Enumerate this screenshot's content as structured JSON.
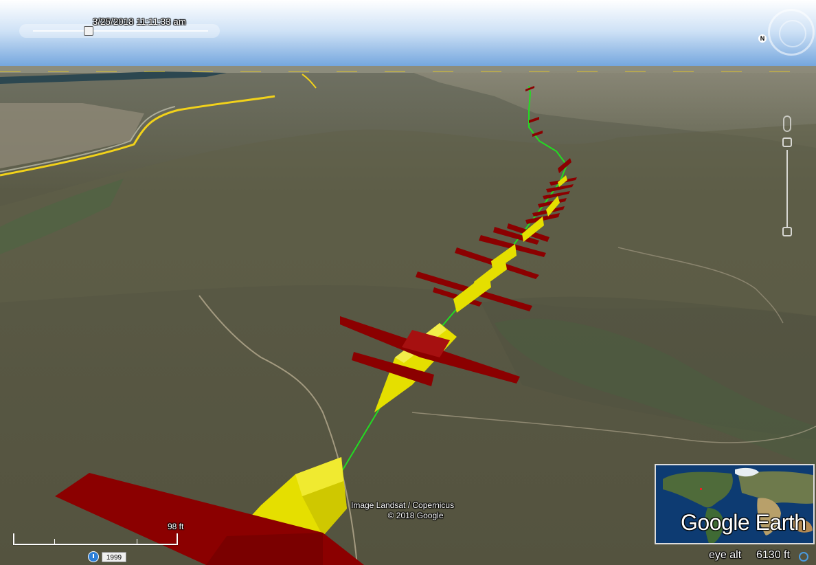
{
  "timestamp": "3/25/2018  11:11:33 am",
  "attribution": {
    "line1": "Image Landsat / Copernicus",
    "line2": "© 2018 Google"
  },
  "scale": {
    "label": "98 ft"
  },
  "imagery_date": "1999",
  "logo": "Google Earth",
  "eye_alt": {
    "label": "eye alt",
    "value": "6130 ft"
  },
  "compass": {
    "north": "N"
  },
  "colors": {
    "wing": "#8b0000",
    "fuselage": "#e5df00",
    "track": "#22dd22",
    "road": "#f2d21a"
  },
  "icons": [
    "compass-icon",
    "zoom-slider-icon",
    "look-joystick-icon",
    "historical-imagery-clock-icon",
    "status-ring-icon"
  ]
}
